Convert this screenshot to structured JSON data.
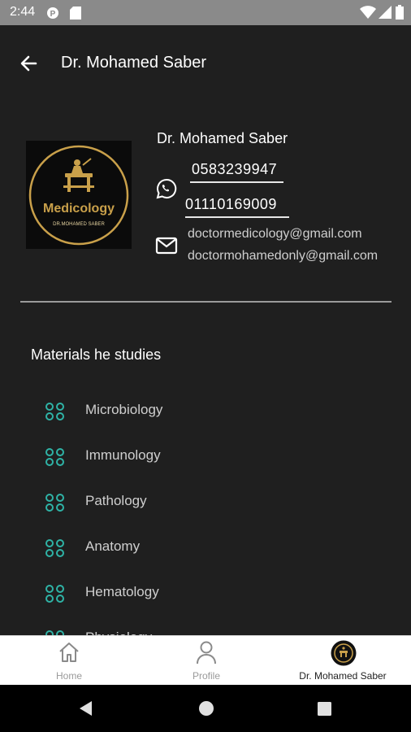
{
  "status": {
    "time": "2:44"
  },
  "appbar": {
    "title": "Dr. Mohamed Saber"
  },
  "profile": {
    "logo_text": "Medicology",
    "logo_subtext": "DR.MOHAMED SABER",
    "name": "Dr. Mohamed Saber",
    "phones": [
      "0583239947",
      "01110169009"
    ],
    "emails": [
      "doctormedicology@gmail.com",
      "doctormohamedonly@gmail.com"
    ]
  },
  "materials": {
    "title": "Materials he studies",
    "items": [
      "Microbiology",
      "Immunology",
      "Pathology",
      "Anatomy",
      "Hematology",
      "Physiology"
    ]
  },
  "bottom_nav": [
    {
      "label": "Home"
    },
    {
      "label": "Profile"
    },
    {
      "label": "Dr. Mohamed Saber"
    }
  ],
  "colors": {
    "accent_teal": "#2fb3a6",
    "gold": "#c9a04a",
    "background": "#1f1f1f"
  }
}
